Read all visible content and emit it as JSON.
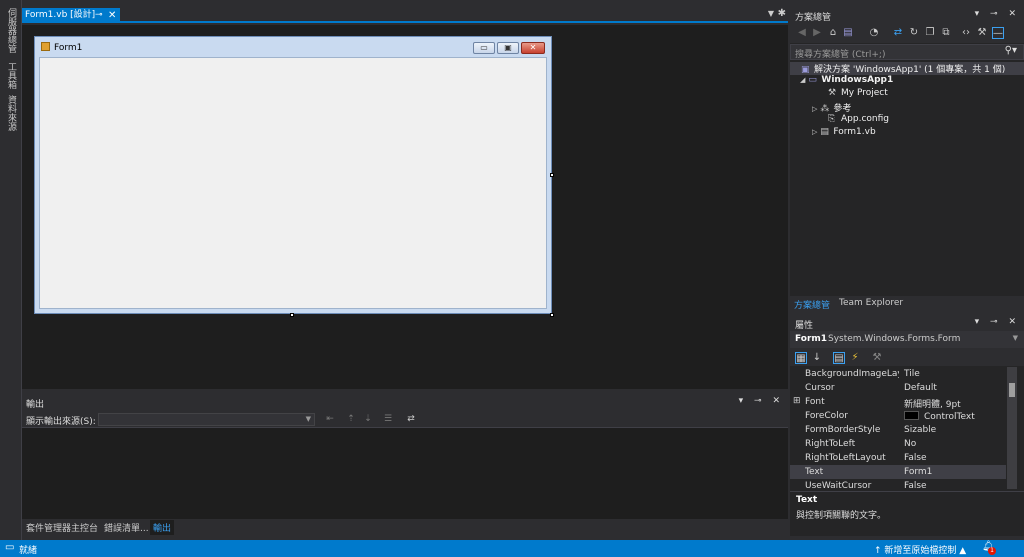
{
  "left_strip": {
    "tab1": "伺服器總管",
    "tab2": "工具箱",
    "tab3": "資料來源"
  },
  "doc_tab": {
    "label": "Form1.vb [設計]",
    "pin": "⊸",
    "close": "✕"
  },
  "form": {
    "title": "Form1"
  },
  "output": {
    "title": "輸出",
    "source_label": "顯示輸出來源(S):",
    "source_value": "",
    "tabs": [
      "套件管理器主控台",
      "錯誤清單...",
      "輸出"
    ]
  },
  "solution_explorer": {
    "title": "方案總管",
    "search_placeholder": "搜尋方案總管 (Ctrl+;)",
    "tree": [
      {
        "label": "解決方案 'WindowsApp1' (1 個專案，共 1 個)",
        "icon": "solution-icon"
      },
      {
        "label": "WindowsApp1",
        "icon": "vb-project-icon"
      },
      {
        "label": "My Project",
        "icon": "wrench-icon"
      },
      {
        "label": "參考",
        "icon": "references-icon"
      },
      {
        "label": "App.config",
        "icon": "config-file-icon"
      },
      {
        "label": "Form1.vb",
        "icon": "form-file-icon"
      }
    ],
    "tabs": [
      "方案總管",
      "Team Explorer"
    ]
  },
  "properties": {
    "title": "屬性",
    "object_name": "Form1",
    "object_type": "System.Windows.Forms.Form",
    "rows": [
      {
        "name": "BackgroundImageLayout",
        "value": "Tile"
      },
      {
        "name": "Cursor",
        "value": "Default"
      },
      {
        "name": "Font",
        "value": "新細明體, 9pt"
      },
      {
        "name": "ForeColor",
        "value": "ControlText"
      },
      {
        "name": "FormBorderStyle",
        "value": "Sizable"
      },
      {
        "name": "RightToLeft",
        "value": "No"
      },
      {
        "name": "RightToLeftLayout",
        "value": "False"
      },
      {
        "name": "Text",
        "value": "Form1"
      },
      {
        "name": "UseWaitCursor",
        "value": "False"
      }
    ],
    "desc_title": "Text",
    "desc_text": "與控制項關聯的文字。"
  },
  "statusbar": {
    "ready": "就緒",
    "source_control": "新增至原始檔控制 ▲",
    "notifications": "1"
  },
  "colors": {
    "accent": "#007acc",
    "panel": "#252526",
    "background": "#2d2d30",
    "editor": "#1e1e1e"
  }
}
